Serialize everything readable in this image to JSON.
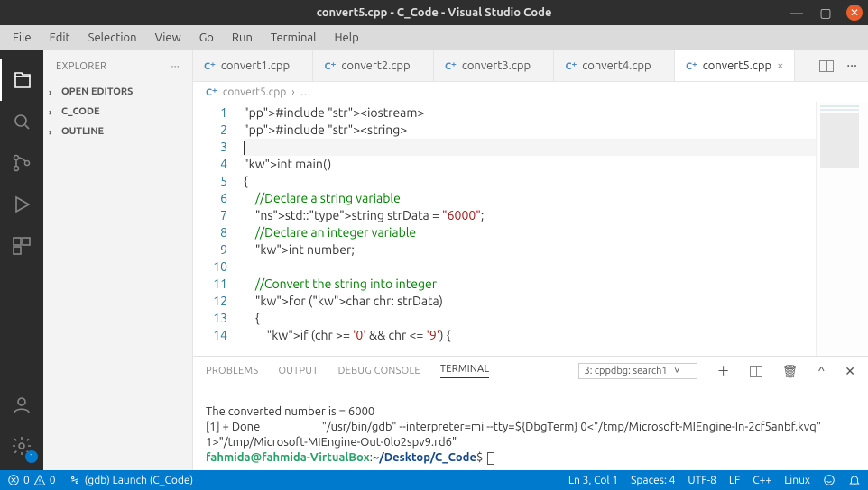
{
  "window": {
    "title": "convert5.cpp - C_Code - Visual Studio Code"
  },
  "menubar": [
    "File",
    "Edit",
    "Selection",
    "View",
    "Go",
    "Run",
    "Terminal",
    "Help"
  ],
  "sidebar": {
    "title": "EXPLORER",
    "sections": [
      "OPEN EDITORS",
      "C_CODE",
      "OUTLINE"
    ]
  },
  "tabs": [
    {
      "label": "convert1.cpp",
      "active": false
    },
    {
      "label": "convert2.cpp",
      "active": false
    },
    {
      "label": "convert3.cpp",
      "active": false
    },
    {
      "label": "convert4.cpp",
      "active": false
    },
    {
      "label": "convert5.cpp",
      "active": true
    }
  ],
  "breadcrumb": {
    "file": "convert5.cpp",
    "sep": "›",
    "rest": "…"
  },
  "code_lines": [
    "#include <iostream>",
    "#include <string>",
    "",
    "int main()",
    "{",
    "    //Declare a string variable",
    "    std::string strData = \"6000\";",
    "    //Declare an integer variable",
    "    int number;",
    "",
    "    //Convert the string into integer",
    "    for (char chr: strData)",
    "    {",
    "        if (chr >= '0' && chr <= '9') {"
  ],
  "panel": {
    "tabs": [
      "PROBLEMS",
      "OUTPUT",
      "DEBUG CONSOLE",
      "TERMINAL"
    ],
    "active_index": 3,
    "terminal_selector": "3: cppdbg: search1",
    "terminal_output_plain": "\nThe converted number is = 6000\n[1] + Done                       \"/usr/bin/gdb\" --interpreter=mi --tty=${DbgTerm} 0<\"/tmp/Microsoft-MIEngine-In-2cf5anbf.kvq\" 1>\"/tmp/Microsoft-MIEngine-Out-0lo2spv9.rd6\"",
    "prompt_user_host": "fahmida@fahmida-VirtualBox",
    "prompt_path": "~/Desktop/C_Code",
    "prompt_suffix": "$"
  },
  "statusbar": {
    "errors": "0",
    "warnings": "0",
    "launch": "(gdb) Launch (C_Code)",
    "position": "Ln 3, Col 1",
    "spaces": "Spaces: 4",
    "encoding": "UTF-8",
    "eol": "LF",
    "lang": "C++",
    "os": "Linux"
  },
  "activity_badge": "1"
}
